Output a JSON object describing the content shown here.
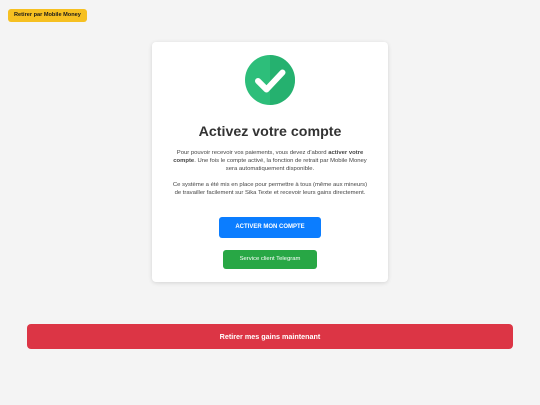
{
  "header": {
    "withdraw_mobile_money_label": "Retirer par Mobile Money"
  },
  "card": {
    "icon": "check-circle-icon",
    "title": "Activez votre compte",
    "paragraph1": {
      "before": "Pour pouvoir recevoir vos paiements, vous devez d'abord ",
      "bold": "activer votre compte",
      "after": ". Une fois le compte activé, la fonction de retrait par Mobile Money sera automatiquement disponible."
    },
    "paragraph2": "Ce système a été mis en place pour permettre à tous (même aux mineurs) de travailler facilement sur Sika Texte et recevoir leurs gains directement.",
    "activate_button_label": "ACTIVER MON COMPTE",
    "telegram_button_label": "Service client Telegram"
  },
  "footer": {
    "withdraw_now_label": "Retirer mes gains maintenant"
  },
  "colors": {
    "accent_yellow": "#f6c021",
    "primary_blue": "#0b7dff",
    "success_green": "#28a745",
    "danger_red": "#dc3545",
    "check_green": "#2dbe7a"
  }
}
